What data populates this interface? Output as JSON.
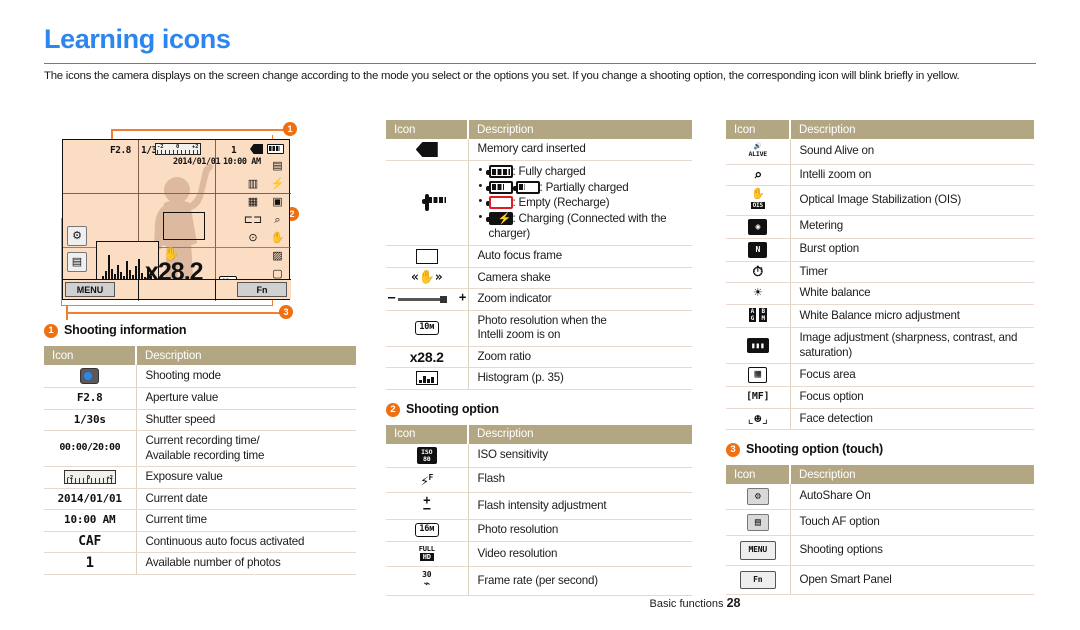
{
  "page": {
    "title": "Learning icons",
    "intro": "The icons the camera displays on the screen change according to the mode you select or the options you set. If you change a shooting option, the corresponding icon will blink briefly in yellow.",
    "footer_label": "Basic functions",
    "footer_page": "28",
    "accent_blue": "#2b86ef",
    "accent_orange": "#ee7010",
    "table_header_bg": "#b3a683",
    "screen_bg": "#fbddc3"
  },
  "camera_screen": {
    "aperture": "F2.8",
    "shutter": "1/30s",
    "date": "2014/01/01",
    "time": "10:00 AM",
    "photo_count": "1",
    "zoom_ratio": "x28.2",
    "minus": "–",
    "plus": "+",
    "resolution_badge": "10м",
    "ev_left": "-2",
    "ev_center": "0",
    "ev_right": "+2",
    "menu_button": "MENU",
    "fn_button": "Fn",
    "callouts": [
      "1",
      "2",
      "3"
    ]
  },
  "sections": {
    "shooting_information": {
      "number": "1",
      "label": "Shooting information",
      "header": {
        "icon": "Icon",
        "description": "Description"
      },
      "rows": [
        {
          "icon": "",
          "icon_type": "shooting-mode-icon",
          "description": "Shooting mode"
        },
        {
          "icon": "F2.8",
          "icon_type": "text",
          "description": "Aperture value"
        },
        {
          "icon": "1/30s",
          "icon_type": "text",
          "description": "Shutter speed"
        },
        {
          "icon": "00:00/20:00",
          "icon_type": "text",
          "description": "Current recording time/\nAvailable recording time"
        },
        {
          "icon": "",
          "icon_type": "exposure-bar-icon",
          "description": "Exposure value"
        },
        {
          "icon": "2014/01/01",
          "icon_type": "text",
          "description": "Current date"
        },
        {
          "icon": "10:00 AM",
          "icon_type": "text",
          "description": "Current time"
        },
        {
          "icon": "CAF",
          "icon_type": "text",
          "description": "Continuous auto focus activated"
        },
        {
          "icon": "1",
          "icon_type": "text",
          "description": "Available number of photos"
        }
      ]
    },
    "middle_table": {
      "header": {
        "icon": "Icon",
        "description": "Description"
      },
      "rows": [
        {
          "icon_type": "memory-card-icon",
          "description": "Memory card inserted"
        },
        {
          "icon_type": "battery-icon",
          "description_list": [
            "Fully charged",
            "Partially charged",
            "Empty (Recharge)",
            "Charging (Connected with the charger)"
          ]
        },
        {
          "icon_type": "af-frame-icon",
          "description": "Auto focus frame"
        },
        {
          "icon_type": "camera-shake-icon",
          "description": "Camera shake"
        },
        {
          "icon_type": "zoom-indicator-icon",
          "description": "Zoom indicator"
        },
        {
          "icon_type": "resolution-10m-icon",
          "icon": "10м",
          "description": "Photo resolution when the\nIntelli zoom is on"
        },
        {
          "icon_type": "text",
          "icon": "x28.2",
          "description": "Zoom ratio"
        },
        {
          "icon_type": "histogram-icon",
          "description": "Histogram (p. 35)"
        }
      ]
    },
    "shooting_option": {
      "number": "2",
      "label": "Shooting option",
      "header": {
        "icon": "Icon",
        "description": "Description"
      },
      "rows": [
        {
          "icon_type": "iso-icon",
          "icon": "ISO 80",
          "description": "ISO sensitivity"
        },
        {
          "icon_type": "flash-icon",
          "icon": "⚡F",
          "description": "Flash"
        },
        {
          "icon_type": "plus-minus-icon",
          "icon": "+/-",
          "description": "Flash intensity adjustment"
        },
        {
          "icon_type": "resolution-16m-icon",
          "icon": "16м",
          "description": "Photo resolution"
        },
        {
          "icon_type": "fullhd-icon",
          "icon": "FULL HD",
          "description": "Video resolution"
        },
        {
          "icon_type": "framerate-icon",
          "icon": "30",
          "description": "Frame rate (per second)"
        }
      ]
    },
    "right_table": {
      "header": {
        "icon": "Icon",
        "description": "Description"
      },
      "rows": [
        {
          "icon_type": "sound-alive-icon",
          "description": "Sound Alive on"
        },
        {
          "icon_type": "intelli-zoom-icon",
          "description": "Intelli zoom on"
        },
        {
          "icon_type": "ois-icon",
          "description": "Optical Image Stabilization (OIS)"
        },
        {
          "icon_type": "metering-icon",
          "description": "Metering"
        },
        {
          "icon_type": "burst-icon",
          "description": "Burst option"
        },
        {
          "icon_type": "timer-icon",
          "description": "Timer"
        },
        {
          "icon_type": "white-balance-icon",
          "description": "White balance"
        },
        {
          "icon_type": "wb-micro-icon",
          "description": "White Balance micro adjustment"
        },
        {
          "icon_type": "image-adjustment-icon",
          "description": "Image adjustment (sharpness, contrast, and saturation)"
        },
        {
          "icon_type": "focus-area-icon",
          "description": "Focus area"
        },
        {
          "icon_type": "focus-option-icon",
          "description": "Focus option"
        },
        {
          "icon_type": "face-detection-icon",
          "description": "Face detection"
        }
      ]
    },
    "shooting_option_touch": {
      "number": "3",
      "label": "Shooting option (touch)",
      "header": {
        "icon": "Icon",
        "description": "Description"
      },
      "rows": [
        {
          "icon_type": "autoshare-icon",
          "description": "AutoShare On"
        },
        {
          "icon_type": "touch-af-icon",
          "description": "Touch AF option"
        },
        {
          "icon_type": "menu-key-icon",
          "icon": "MENU",
          "description": "Shooting options"
        },
        {
          "icon_type": "fn-key-icon",
          "icon": "Fn",
          "description": "Open Smart Panel"
        }
      ]
    }
  }
}
